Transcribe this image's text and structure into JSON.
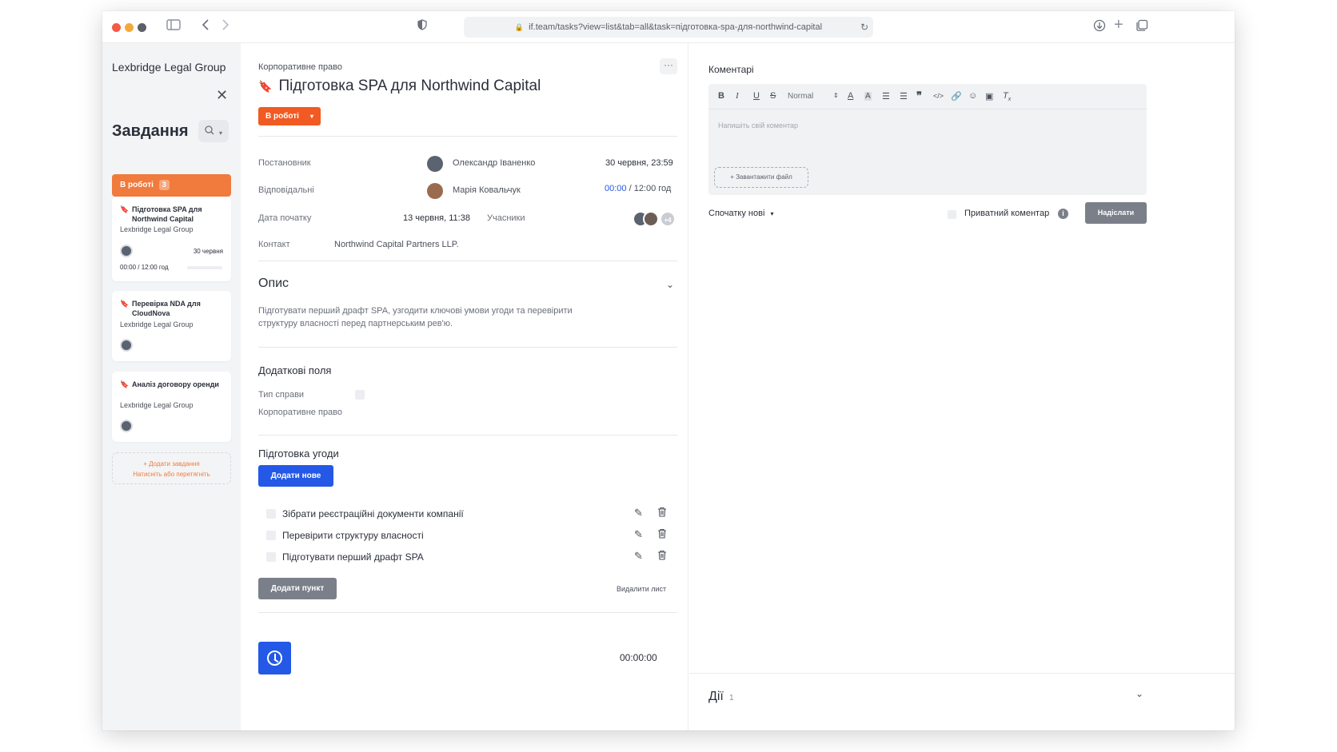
{
  "browser": {
    "url": "if.team/tasks?view=list&tab=all&task=підготовка-spa-для-northwind-capital",
    "traffic_colors": [
      "#f25c47",
      "#f5a83b",
      "#5a5f69"
    ]
  },
  "sidebar": {
    "org_name": "Lexbridge Legal Group",
    "title": "Завдання",
    "status_column": {
      "label": "В роботі",
      "count": "3",
      "color": "#f07b3c"
    },
    "cards": [
      {
        "title": "Підготовка SPA для Northwind Capital",
        "company": "Lexbridge Legal Group",
        "date": "30 червня",
        "time": "00:00 / 12:00 год"
      },
      {
        "title": "Перевірка NDA для CloudNova",
        "company": "Lexbridge Legal Group"
      },
      {
        "title": "Аналіз договору оренди",
        "company": "Lexbridge Legal Group"
      }
    ],
    "add_task": {
      "line1": "+ Додати завдання",
      "line2": "Натисніть або перетягніть"
    }
  },
  "task": {
    "category": "Корпоративне право",
    "title": "Підготовка SPA для Northwind Capital",
    "status": "В роботі",
    "fields": {
      "creator_label": "Постановник",
      "creator_name": "Олександр Іваненко",
      "created_at": "30 червня, 23:59",
      "assignee_label": "Відповідальні",
      "assignee_name": "Марія Ковальчук",
      "time_spent": "00:00",
      "time_estimate": " / 12:00 год",
      "start_label": "Дата початку",
      "start_value": "13 червня, 11:38",
      "participants_label": "Учасники",
      "participants_more": "+4",
      "contact_label": "Контакт",
      "contact_value": "Northwind Capital Partners LLP."
    },
    "description": {
      "heading": "Опис",
      "text": "Підготувати перший драфт SPA, узгодити ключові умови угоди та перевірити структуру власності перед партнерським рев'ю."
    },
    "extra_fields": {
      "heading": "Додаткові поля",
      "case_type_label": "Тип справи",
      "case_type_value": "Корпоративне право"
    },
    "checklist": {
      "heading": "Підготовка угоди",
      "add_new": "Додати нове",
      "items": [
        "Зібрати реєстраційні документи компанії",
        "Перевірити структуру власності",
        "Підготувати перший драфт SPA"
      ],
      "add_item": "Додати пункт",
      "delete_list": "Видалити лист"
    },
    "timer": "00:00:00"
  },
  "comments": {
    "heading": "Коментарі",
    "format_select": "Normal",
    "placeholder": "Напишіть свій коментар",
    "upload": "+ Завантажити файл",
    "sort": "Спочатку нові",
    "private_label": "Приватний коментар",
    "send": "Надіслати"
  },
  "actions": {
    "heading": "Дії",
    "count": "1"
  }
}
